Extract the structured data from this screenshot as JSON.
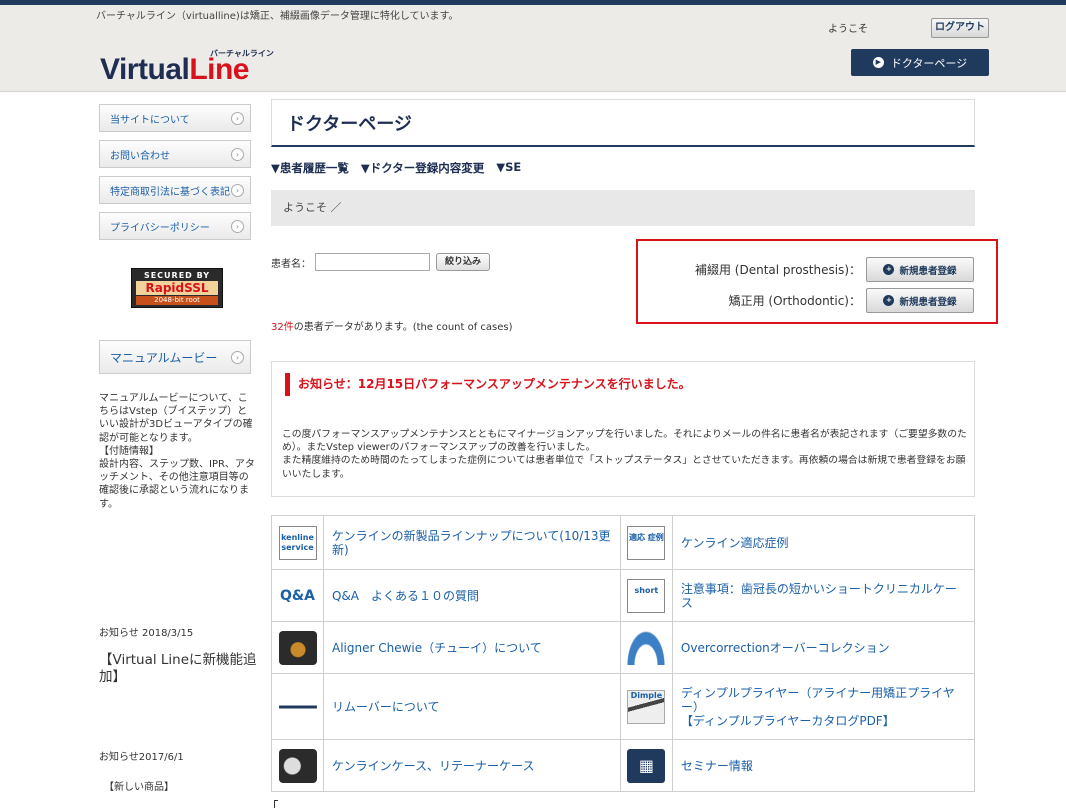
{
  "header": {
    "description": "バーチャルライン（virtualline)は矯正、補綴画像データ管理に特化しています。",
    "logo_main": "Virtual",
    "logo_accent": "Line",
    "logo_kana": "バーチャルライン",
    "welcome": "ようこそ",
    "logout_label": "ログアウト",
    "doctor_page_label": "ドクターページ"
  },
  "sidebar": {
    "menu": [
      {
        "label": "当サイトについて"
      },
      {
        "label": "お問い合わせ"
      },
      {
        "label": "特定商取引法に基づく表記"
      },
      {
        "label": "プライバシーポリシー"
      }
    ],
    "ssl": {
      "top": "SECURED BY",
      "mid": "RapidSSL",
      "bot": "2048-bit root"
    },
    "manual_label": "マニュアルムービー",
    "manual_text": "マニュアルムービーについて、こちらはVstep（ブイステップ）といい設計が3Dビューアタイプの確認が可能となります。\n【付随情報】\n設計内容、ステップ数、IPR、アタッチメント、その他注意項目等の確認後に承認という流れになります。",
    "news1_date": "お知らせ 2018/3/15",
    "news1_title": "【Virtual Lineに新機能追加】",
    "news2_date": "お知らせ2017/6/1",
    "news2_title": "【新しい商品】"
  },
  "main": {
    "page_title": "ドクターページ",
    "subnav": [
      "▼患者履歴一覧",
      "▼ドクター登録内容変更",
      "▼SE"
    ],
    "welcome_bar": "ようこそ ／",
    "patient_label": "患者名：",
    "filter_label": "絞り込み",
    "count_num": "32件",
    "count_text": "の患者データがあります。(the count of cases)",
    "register": [
      {
        "label": "補綴用 (Dental prosthesis)：",
        "button": "新規患者登録"
      },
      {
        "label": "矯正用 (Orthodontic)：",
        "button": "新規患者登録"
      }
    ],
    "notice_title": "お知らせ：12月15日パフォーマンスアップメンテナンスを行いました。",
    "notice_body": "この度パフォーマンスアップメンテナンスとともにマイナージョンアップを行いました。それによりメールの件名に患者名が表記されます（ご要望多数のため）。またVstep viewerのパフォーマンスアップの改善を行いました。\nまた精度維持のため時間のたってしまった症例については患者単位で「ストップステータス」とさせていただきます。再依頼の場合は新規で患者登録をお願いいたします。",
    "links": [
      [
        {
          "icon": "kenline-service-icon",
          "icon_text": "kenline service",
          "text": "ケンラインの新製品ラインナップについて(10/13更新)"
        },
        {
          "icon": "adaptation-case-icon",
          "icon_text": "適応 症例",
          "text": "ケンライン適応症例"
        }
      ],
      [
        {
          "icon": "qa-icon",
          "icon_text": "Q&A",
          "text": "Q&A　よくある１０の質問"
        },
        {
          "icon": "short-clinical-icon",
          "icon_text": "short",
          "text": "注意事項：歯冠長の短かいショートクリニカルケース"
        }
      ],
      [
        {
          "icon": "chewie-icon",
          "icon_text": "",
          "text": "Aligner Chewie（チューイ）について"
        },
        {
          "icon": "dental-arch-icon",
          "icon_text": "",
          "text": "Overcorrectionオーバーコレクション"
        }
      ],
      [
        {
          "icon": "remover-icon",
          "icon_text": "",
          "text": "リムーバーについて"
        },
        {
          "icon": "dimple-plier-icon",
          "icon_text": "Dimple",
          "text": "ディンプルプライヤー（アライナー用矯正プライヤー）\n【ディンプルプライヤーカタログPDF】"
        }
      ],
      [
        {
          "icon": "case-retainer-icon",
          "icon_text": "",
          "text": "ケンラインケース、リテーナーケース"
        },
        {
          "icon": "seminar-icon",
          "icon_text": "",
          "text": "セミナー情報"
        }
      ]
    ]
  }
}
